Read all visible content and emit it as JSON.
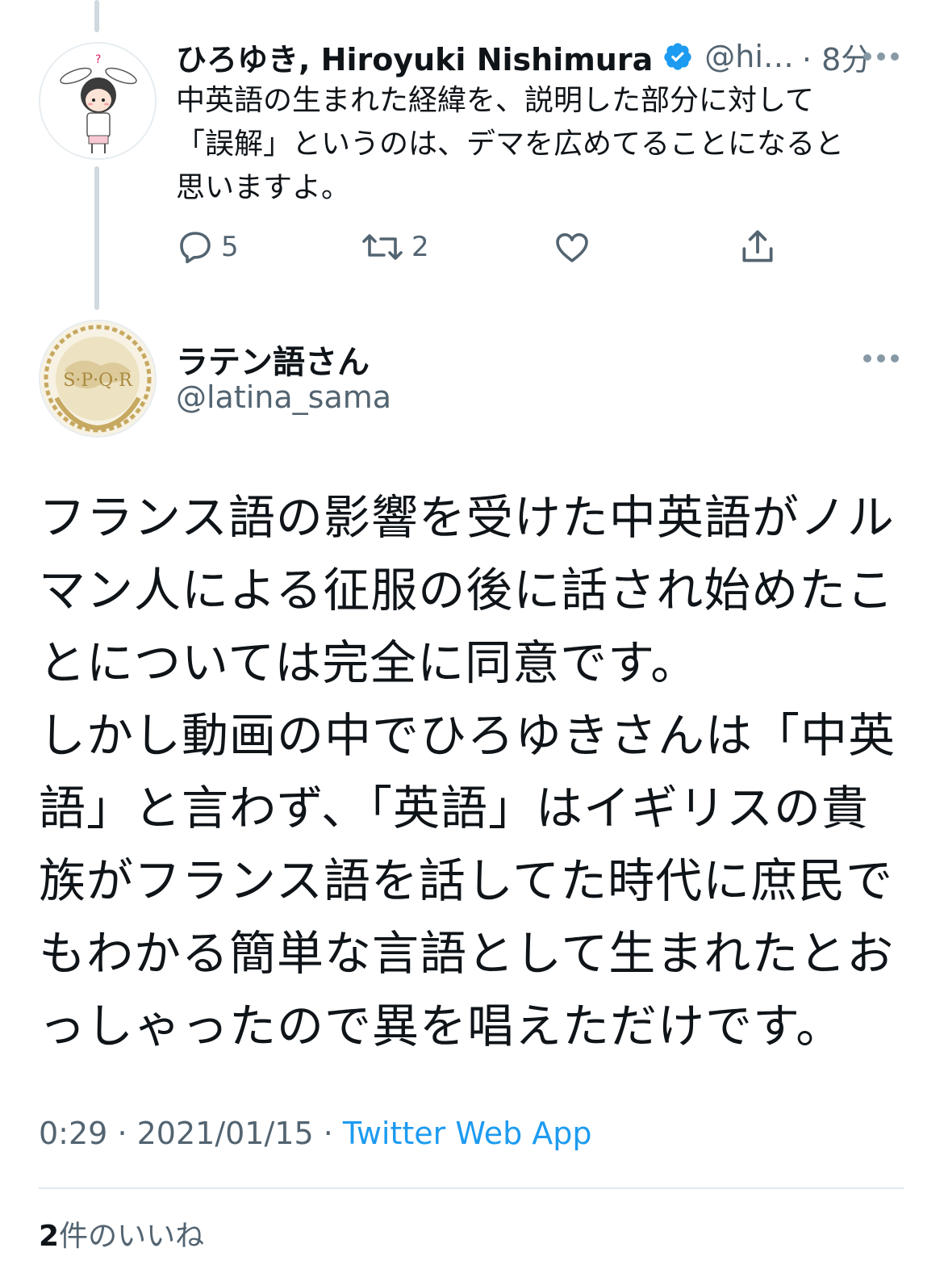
{
  "reply_tweet": {
    "display_name": "ひろゆき, Hiroyuki Nishimura",
    "handle": "@hi…",
    "time_ago": "· 8分",
    "text_lines": [
      "中英語の生まれた経緯を、説明した部分に対して",
      "「誤解」というのは、デマを広めてることになると",
      "思いますよ。"
    ],
    "reply_count": "5",
    "retweet_count": "2",
    "verified_icon": "verified-badge",
    "avatar_mark": "?"
  },
  "main_tweet": {
    "display_name": "ラテン語さん",
    "handle": "@latina_sama",
    "avatar_text": "S·P·Q·R",
    "text_lines": [
      "フランス語の影響を受けた中英語がノル",
      "マン人による征服の後に話され始めたこ",
      "とについては完全に同意です。",
      "しかし動画の中でひろゆきさんは「中英",
      "語」と言わず、「英語」はイギリスの貴",
      "族がフランス語を話してた時代に庶民で",
      "もわかる簡単な言語として生まれたとお",
      "っしゃったので異を唱えただけです。"
    ],
    "time": "0:29",
    "date": "2021/01/15",
    "source": "Twitter Web App",
    "likes_count": "2",
    "likes_label": "件のいいね"
  },
  "colors": {
    "accent": "#1d9bf0",
    "secondary_text": "#536471",
    "primary_text": "#0f1419",
    "divider": "#e1e8ed",
    "thread_line": "#cfd9de"
  }
}
